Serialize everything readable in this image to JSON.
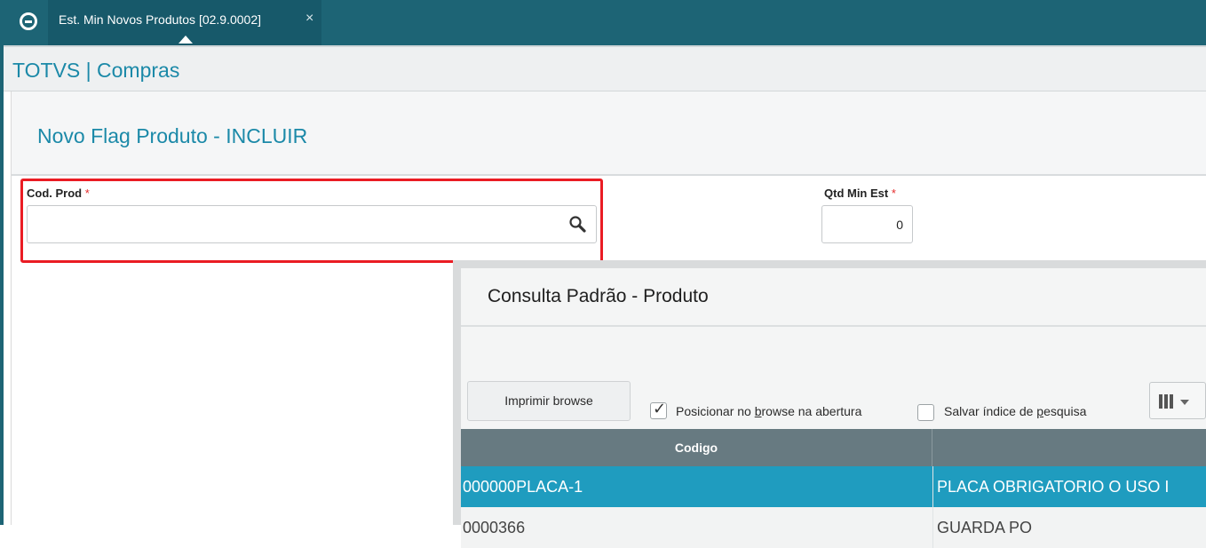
{
  "tab": {
    "label": "Est. Min Novos Produtos [02.9.0002]",
    "close": "×"
  },
  "module": {
    "title": "TOTVS | Compras"
  },
  "form": {
    "title": "Novo Flag Produto - INCLUIR",
    "cod_prod": {
      "label": "Cod. Prod",
      "required_mark": "*",
      "value": ""
    },
    "qtd_min": {
      "label": "Qtd Min Est",
      "required_mark": "*",
      "value": "0"
    }
  },
  "dialog": {
    "title": "Consulta Padrão - Produto",
    "print_button": "Imprimir browse",
    "opt_position": {
      "pre": "Posicionar no ",
      "u": "b",
      "post": "rowse na abertura",
      "checked": true
    },
    "opt_save": {
      "pre": "Salvar índice de ",
      "u": "p",
      "post": "esquisa",
      "checked": false
    },
    "grid": {
      "columns": [
        "Codigo",
        ""
      ],
      "rows": [
        {
          "codigo": "000000PLACA-1",
          "descricao": "PLACA OBRIGATORIO O USO I"
        },
        {
          "codigo": "0000366",
          "descricao": "GUARDA PO"
        }
      ]
    }
  }
}
